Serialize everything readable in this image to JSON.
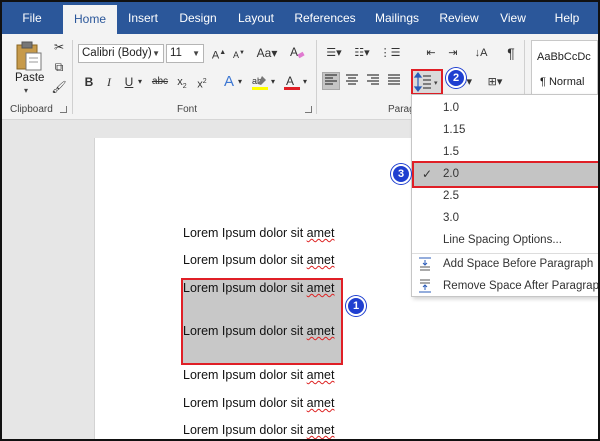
{
  "tabs": [
    "File",
    "Home",
    "Insert",
    "Design",
    "Layout",
    "References",
    "Mailings",
    "Review",
    "View",
    "Help"
  ],
  "clipboard": {
    "paste_label": "Paste",
    "group_label": "Clipboard"
  },
  "font": {
    "name": "Calibri (Body)",
    "size": "11",
    "group_label": "Font"
  },
  "paragraph": {
    "group_label": "Parag"
  },
  "styles": {
    "sample": "AaBbCcDc",
    "name": "¶ Normal"
  },
  "document": {
    "lines": [
      "Lorem Ipsum dolor sit amet",
      "Lorem Ipsum dolor sit amet",
      "Lorem Ipsum dolor sit amet",
      "Lorem Ipsum dolor sit amet",
      "Lorem Ipsum dolor sit amet",
      "Lorem Ipsum dolor sit amet",
      "Lorem Ipsum dolor sit amet"
    ],
    "word_prefix": "Lorem Ipsum dolor sit ",
    "word_squiggle": "amet"
  },
  "line_spacing_menu": {
    "options": [
      "1.0",
      "1.15",
      "1.5",
      "2.0",
      "2.5",
      "3.0"
    ],
    "selected": "2.0",
    "more_options": "Line Spacing Options...",
    "add_space_before": "Add Space Before Paragraph",
    "remove_space_after": "Remove Space After Paragraph"
  },
  "callouts": [
    "1",
    "2",
    "3"
  ],
  "colors": {
    "accent": "#2b579a",
    "highlight_red": "#e01f26",
    "callout_blue": "#1f3fd0"
  }
}
